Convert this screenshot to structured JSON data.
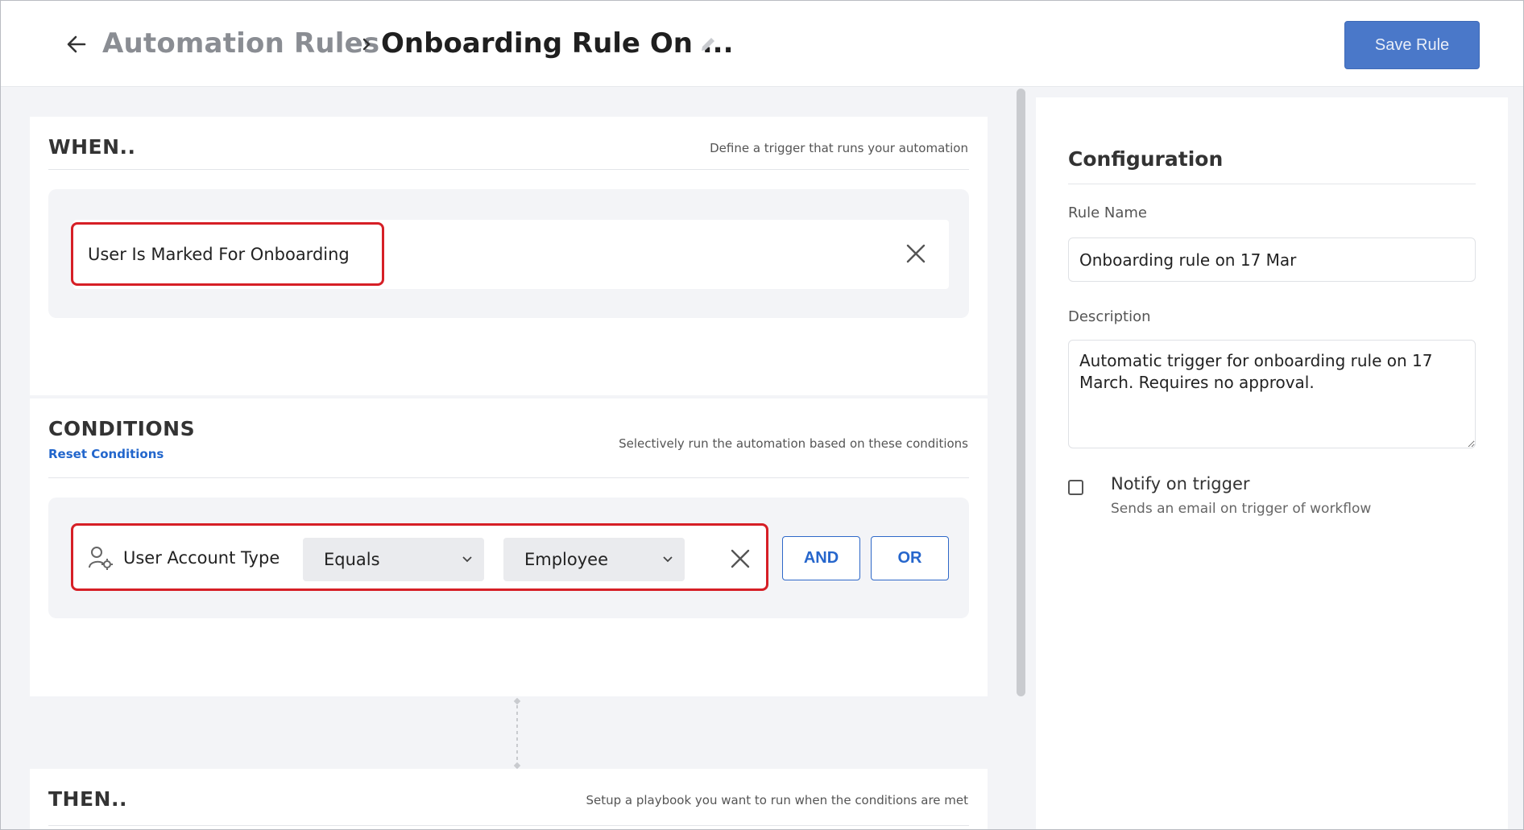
{
  "header": {
    "breadcrumb_parent": "Automation Rules",
    "current_title": "Onboarding Rule On ...",
    "save_label": "Save Rule"
  },
  "when": {
    "title": "WHEN..",
    "help": "Define a trigger that runs your automation",
    "trigger": "User Is Marked For Onboarding"
  },
  "conditions": {
    "title": "CONDITIONS",
    "reset_label": "Reset Conditions",
    "help": "Selectively run the automation based on these conditions",
    "rows": [
      {
        "field": "User Account Type",
        "operator": "Equals",
        "value": "Employee"
      }
    ],
    "and_label": "AND",
    "or_label": "OR"
  },
  "then": {
    "title": "THEN..",
    "help": "Setup a playbook you want to run when the conditions are met"
  },
  "configuration": {
    "title": "Configuration",
    "rule_name_label": "Rule Name",
    "rule_name_value": "Onboarding rule on 17 Mar",
    "description_label": "Description",
    "description_value": "Automatic trigger for onboarding rule on 17 March. Requires no approval.",
    "notify_label": "Notify on trigger",
    "notify_sub": "Sends an email on trigger of workflow",
    "notify_checked": false
  },
  "colors": {
    "accent": "#4a78c9",
    "highlight": "#d61f26",
    "link": "#2266cc"
  }
}
